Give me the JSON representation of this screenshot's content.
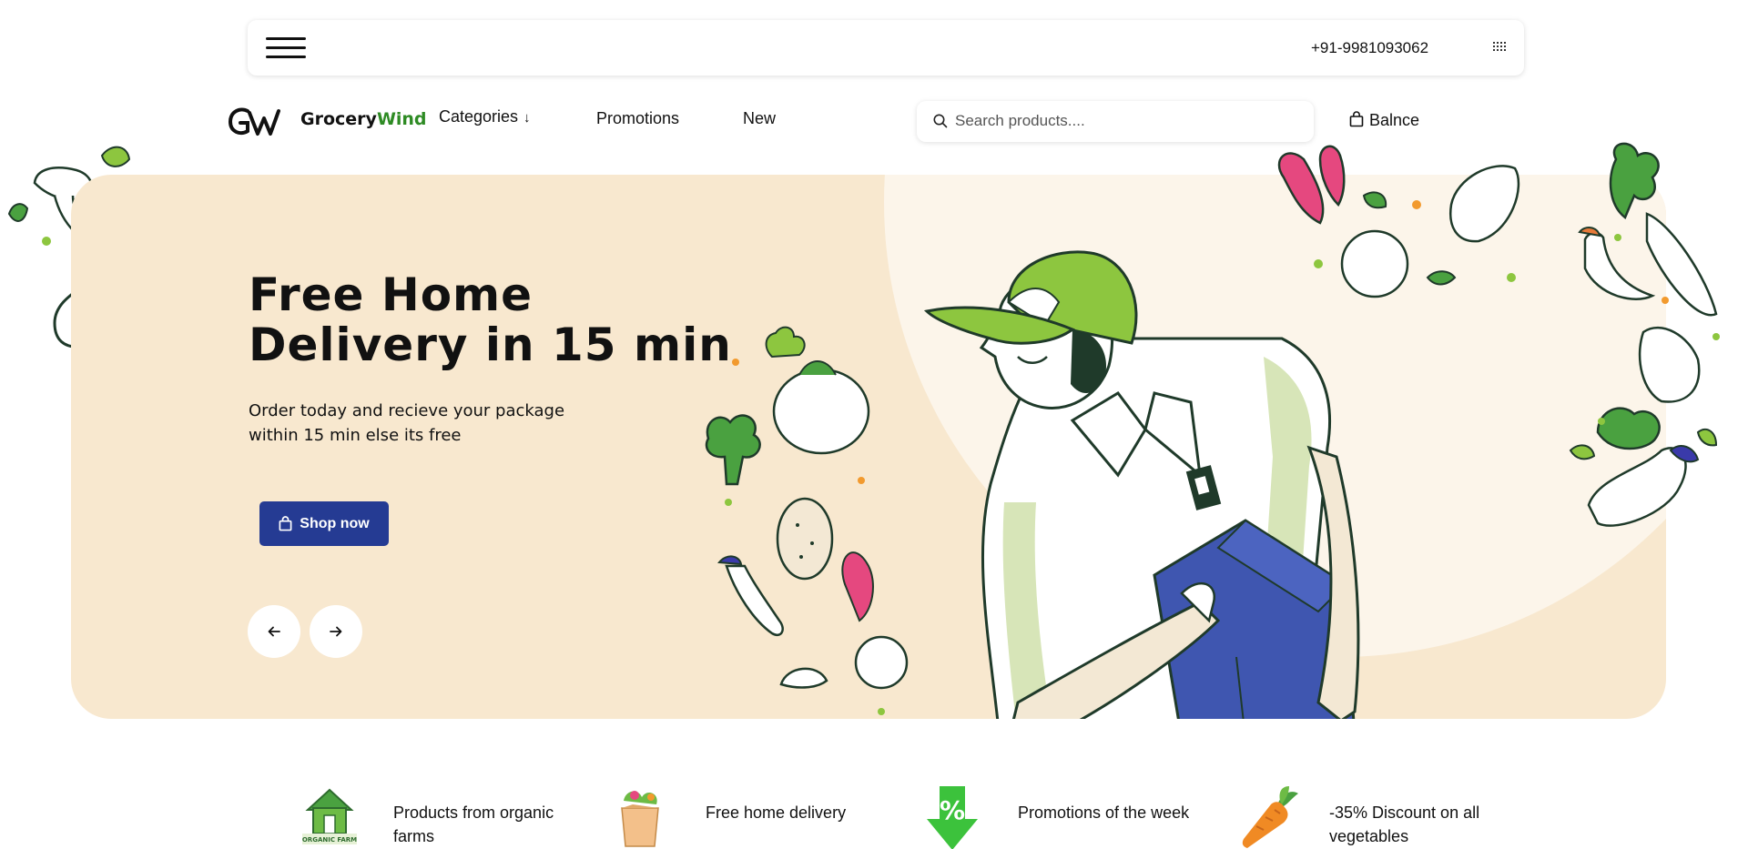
{
  "topbar": {
    "phone": "+91-9981093062"
  },
  "nav": {
    "logo_text": "GW",
    "brand_prefix": "Grocery",
    "brand_accent": "Wind",
    "links": [
      {
        "label": "Categories"
      },
      {
        "label": "Promotions"
      },
      {
        "label": "New"
      }
    ],
    "search_placeholder": "Search products....",
    "cart_label": "Balnce"
  },
  "hero": {
    "title": "Free Home Delivery in 15 min",
    "subtitle": "Order today and recieve your package within 15 min else its free",
    "cta_label": "Shop now"
  },
  "features": [
    {
      "text": "Products from organic farms",
      "icon": "organic-farm-icon",
      "badge": "ORGANIC FARM"
    },
    {
      "text": "Free home delivery",
      "icon": "grocery-bag-icon"
    },
    {
      "text": "Promotions of the week",
      "icon": "percent-arrow-icon",
      "badge": "%"
    },
    {
      "text": "-35% Discount on all vegetables",
      "icon": "carrot-icon"
    }
  ],
  "colors": {
    "hero_bg": "#f8e8cf",
    "primary_button": "#253b93",
    "brand_green": "#2e8b24",
    "cap_green": "#8dc63f",
    "box_blue": "#3f56b0",
    "outline_dark": "#1f3a2a"
  }
}
